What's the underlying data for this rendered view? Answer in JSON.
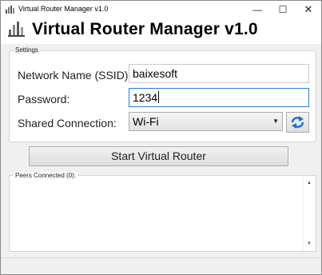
{
  "window": {
    "title": "Virtual Router Manager v1.0",
    "minimize": "—",
    "maximize": "☐",
    "close": "✕"
  },
  "header": {
    "title": "Virtual Router Manager v1.0"
  },
  "settings": {
    "legend": "Settings",
    "ssid_label": "Network Name (SSID):",
    "ssid_value": "baixesoft",
    "password_label": "Password:",
    "password_value": "1234",
    "shared_label": "Shared Connection:",
    "shared_value": "Wi-Fi",
    "dropdown_arrow": "▼"
  },
  "start_button": {
    "label": "Start Virtual Router"
  },
  "peers": {
    "legend": "Peers Connected (0):",
    "scroll_up": "▲",
    "scroll_down": "▼"
  },
  "colors": {
    "focus_border": "#2a7bd6",
    "refresh_icon": "#1d6fd6"
  }
}
